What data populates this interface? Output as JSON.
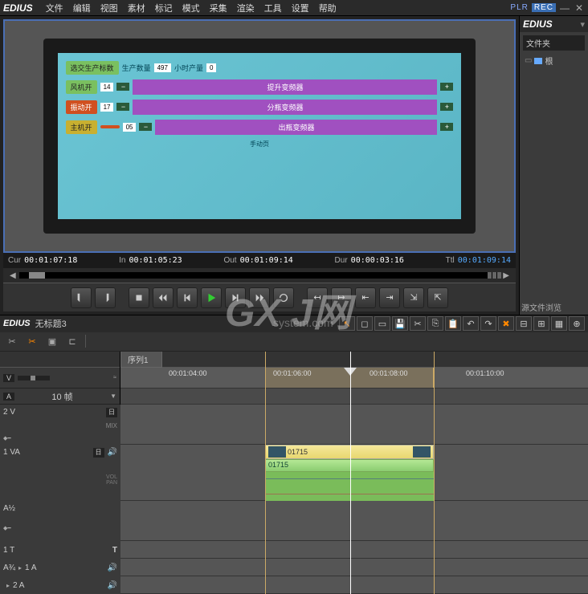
{
  "app": {
    "name": "EDIUS"
  },
  "menu": [
    "文件",
    "编辑",
    "视图",
    "素材",
    "标记",
    "模式",
    "采集",
    "渲染",
    "工具",
    "设置",
    "帮助"
  ],
  "title": {
    "plr": "PLR",
    "rec": "REC"
  },
  "side": {
    "app": "EDIUS",
    "folder_header": "文件夹",
    "root": "根",
    "browser": "源文件浏览"
  },
  "hmi": {
    "header1": "选交生产标数",
    "header2": "生产数量",
    "header3": "497",
    "header4": "小时产量",
    "header5": "0",
    "rows": [
      {
        "btn": "风机开",
        "num": "14",
        "label": "提升变频器"
      },
      {
        "btn": "振动开",
        "num": "17",
        "label": "分瓶变频器"
      },
      {
        "btn": "主机开",
        "num": "05",
        "label": "出瓶变频器"
      }
    ],
    "footer": "手动页"
  },
  "timecodes": {
    "cur_l": "Cur",
    "cur": "00:01:07:18",
    "in_l": "In",
    "in": "00:01:05:23",
    "out_l": "Out",
    "out": "00:01:09:14",
    "dur_l": "Dur",
    "dur": "00:00:03:16",
    "ttl_l": "Ttl",
    "ttl": "00:01:09:14"
  },
  "timeline": {
    "project": "无标题3",
    "sequence": "序列1",
    "frames_label": "10 帧",
    "ruler": [
      "00:01:04:00",
      "00:01:06:00",
      "00:01:08:00",
      "00:01:10:00"
    ],
    "tracks": {
      "v2": "2 V",
      "mix": "MIX",
      "va1": "1 VA",
      "vol": "VOL",
      "pan": "PAN",
      "a12": "A½",
      "t1": "1 T",
      "a34": "A¾",
      "a1": "1 A",
      "a2": "2 A"
    },
    "clip_name": "01715"
  },
  "watermark": {
    "main": "GX J网",
    "sub": "system.com"
  }
}
